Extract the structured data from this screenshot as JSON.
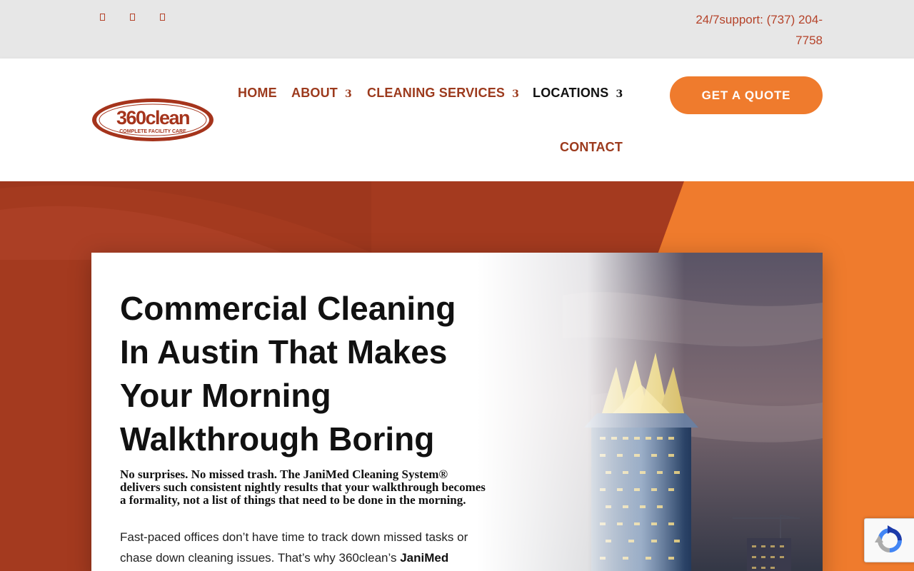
{
  "topbar": {
    "social_icons": [
      "facebook-icon",
      "twitter-icon",
      "instagram-icon"
    ],
    "support_text": "24/7support: (737) 204-7758"
  },
  "logo": {
    "brand": "360clean",
    "tagline": "COMPLETE FACILITY CARE"
  },
  "nav": {
    "home": "HOME",
    "about": "ABOUT",
    "cleaning_services": "CLEANING SERVICES",
    "locations": "LOCATIONS",
    "contact": "CONTACT",
    "caret": "3"
  },
  "cta": {
    "quote_label": "GET A QUOTE"
  },
  "hero": {
    "headline": "Commercial Cleaning In Austin That Makes Your Morning Walkthrough Boring",
    "lead": "No surprises. No missed trash. The JaniMed Cleaning System® delivers such consistent nightly results that your walkthrough becomes a formality, not a list of things that need to be done in the morning.",
    "body_start": "Fast-paced offices don’t have time to track down missed tasks or chase down cleaning issues. That’s why 360clean’s ",
    "body_bold": "JaniMed"
  },
  "colors": {
    "accent_orange": "#ef7b2d",
    "brand_rust": "#9c3a1d",
    "hero_rust": "#a43a1f",
    "topbar_bg": "#e7e7e7"
  }
}
